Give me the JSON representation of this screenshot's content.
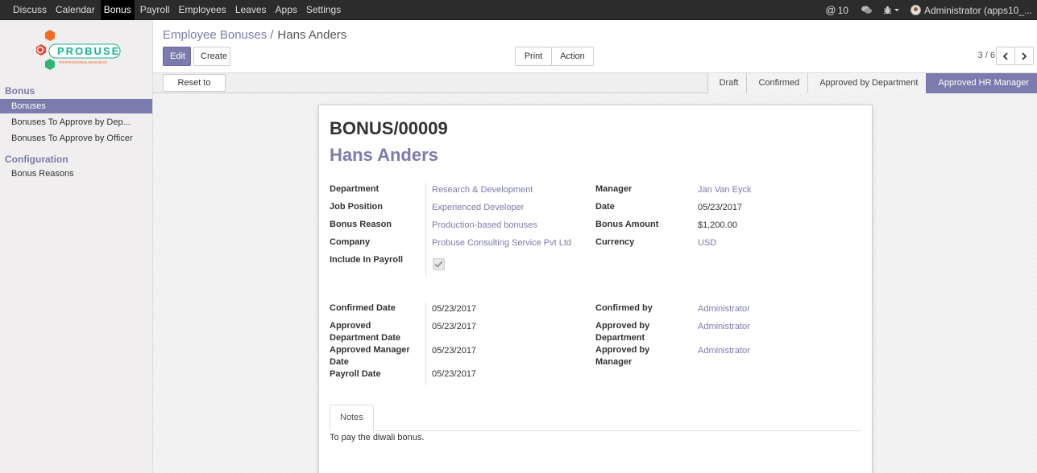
{
  "topbar": {
    "menu": [
      "Discuss",
      "Calendar",
      "Bonus",
      "Payroll",
      "Employees",
      "Leaves",
      "Apps",
      "Settings"
    ],
    "active_menu": "Bonus",
    "message_count": "10",
    "user": "Administrator (apps10_..."
  },
  "sidebar": {
    "logo_text": "PROBUSE",
    "logo_subtext": "PROFESSIONAL BUSINESS",
    "section_bonus": "Bonus",
    "items": [
      "Bonuses",
      "Bonuses To Approve by Dep...",
      "Bonuses To Approve by Officer"
    ],
    "section_config": "Configuration",
    "config_items": [
      "Bonus Reasons"
    ]
  },
  "control": {
    "breadcrumb_parent": "Employee Bonuses",
    "breadcrumb_sep": "/",
    "breadcrumb_current": "Hans Anders",
    "edit": "Edit",
    "create": "Create",
    "print": "Print",
    "action": "Action",
    "pager": "3 / 6"
  },
  "statusbar": {
    "reset": "Reset to Draft",
    "stages": [
      "Draft",
      "Confirmed",
      "Approved by Department",
      "Approved HR Manager"
    ],
    "active_stage": "Approved HR Manager"
  },
  "form": {
    "reference": "BONUS/00009",
    "employee": "Hans Anders",
    "labels": {
      "department": "Department",
      "job_position": "Job Position",
      "bonus_reason": "Bonus Reason",
      "company": "Company",
      "include_payroll": "Include In Payroll",
      "manager": "Manager",
      "date": "Date",
      "bonus_amount": "Bonus Amount",
      "currency": "Currency",
      "confirmed_date": "Confirmed Date",
      "approved_dept_date_1": "Approved",
      "approved_dept_date_2": "Department Date",
      "approved_mgr_date_1": "Approved Manager",
      "approved_mgr_date_2": "Date",
      "payroll_date": "Payroll Date",
      "confirmed_by": "Confirmed by",
      "approved_by_dept_1": "Approved by",
      "approved_by_dept_2": "Department",
      "approved_by_mgr_1": "Approved by",
      "approved_by_mgr_2": "Manager"
    },
    "values": {
      "department": "Research & Development",
      "job_position": "Experienced Developer",
      "bonus_reason": "Production-based bonuses",
      "company": "Probuse Consulting Service Pvt Ltd",
      "include_payroll": true,
      "manager": "Jan Van Eyck",
      "date": "05/23/2017",
      "bonus_amount": "$1,200.00",
      "currency": "USD",
      "confirmed_date": "05/23/2017",
      "approved_dept_date": "05/23/2017",
      "approved_mgr_date": "05/23/2017",
      "payroll_date": "05/23/2017",
      "confirmed_by": "Administrator",
      "approved_by_dept": "Administrator",
      "approved_by_mgr": "Administrator"
    },
    "tab_notes": "Notes",
    "notes": "To pay the diwali bonus."
  },
  "colors": {
    "accent": "#7c7bad",
    "topbar": "#2c2c2c",
    "sidebar": "#f0eeee"
  }
}
